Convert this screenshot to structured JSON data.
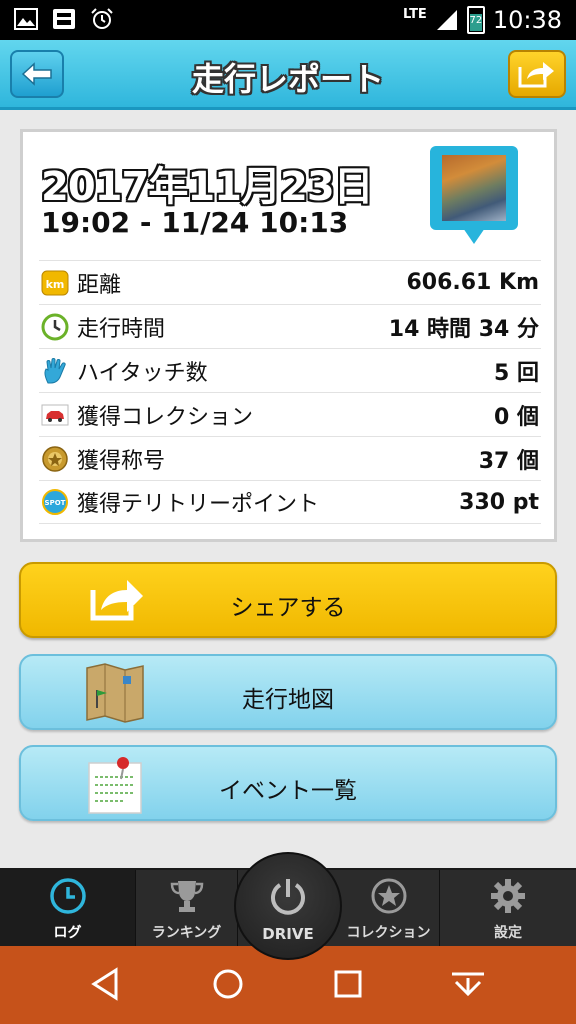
{
  "status_bar": {
    "network": "LTE",
    "battery": "72",
    "time": "10:38",
    "icons": [
      "image-icon",
      "app-notification-icon",
      "alarm-icon",
      "signal-icon",
      "battery-icon"
    ]
  },
  "header": {
    "title": "走行レポート",
    "back_icon": "arrow-left-icon",
    "share_icon": "share-icon"
  },
  "report": {
    "date": "2017年11月23日",
    "time_range": "19:02 - 11/24 10:13",
    "rows": [
      {
        "icon": "km-icon",
        "label": "距離",
        "value": "606.61 Km"
      },
      {
        "icon": "clock-icon",
        "label": "走行時間",
        "value": "14 時間 34 分"
      },
      {
        "icon": "hand-icon",
        "label": "ハイタッチ数",
        "value": "5 回"
      },
      {
        "icon": "car-icon",
        "label": "獲得コレクション",
        "value": "0 個"
      },
      {
        "icon": "medal-icon",
        "label": "獲得称号",
        "value": "37 個"
      },
      {
        "icon": "spot-icon",
        "label": "獲得テリトリーポイント",
        "value": "330 pt"
      }
    ],
    "km_badge": "km",
    "spot_badge": "SPOT"
  },
  "actions": {
    "share_label": "シェアする",
    "map_label": "走行地図",
    "events_label": "イベント一覧"
  },
  "tabs": {
    "log": "ログ",
    "ranking": "ランキング",
    "drive": "DRIVE",
    "collection": "コレクション",
    "settings": "設定"
  },
  "colors": {
    "header": "#2fb6dc",
    "share_button": "#ffd21d",
    "secondary_button": "#9ddcf0",
    "nav_bar": "#c6521a",
    "active_tab": "#2fb6dc"
  }
}
